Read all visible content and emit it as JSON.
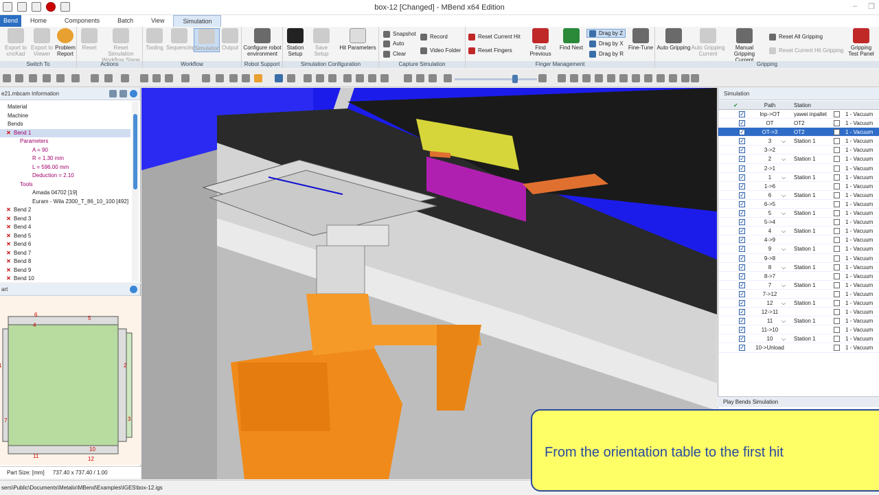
{
  "window": {
    "title": "box-12 [Changed] - MBend x64 Edition"
  },
  "tabs": [
    "Bend",
    "Home",
    "Components",
    "Batch",
    "View",
    "Simulation"
  ],
  "ribbon": {
    "groups": [
      {
        "label": "Switch To"
      },
      {
        "label": "Actions"
      },
      {
        "label": "Workflow"
      },
      {
        "label": "Robot Support"
      },
      {
        "label": "Simulation Configuration"
      },
      {
        "label": "Capture Simulation"
      },
      {
        "label": "Finger Management"
      },
      {
        "label": "Gripping"
      }
    ],
    "buttons": {
      "export_cadcad": "Export to cncKad",
      "export_viewer": "Export to Viewer",
      "problem_report": "Problem Report",
      "reset": "Reset",
      "reset_workflow": "Reset Simulation Workflow Stage",
      "tooling": "Tooling",
      "sequencing": "Sequencing",
      "simulation": "Simulation",
      "output": "Output",
      "configure_robot": "Configure robot environment",
      "station_setup": "Station Setup",
      "save_setup": "Save Setup",
      "hit_parameters": "Hit Parameters",
      "snapshot": "Snapshot",
      "auto": "Auto",
      "clear": "Clear",
      "record": "Record",
      "video_folder": "Video Folder",
      "reset_current_hit": "Reset Current Hit",
      "reset_fingers": "Reset Fingers",
      "find_previous": "Find Previous",
      "find_next": "Find Next",
      "drag_z": "Drag by Z",
      "drag_x": "Drag by X",
      "drag_r": "Drag by R",
      "fine_tune": "Fine-Tune",
      "auto_gripping": "Auto Gripping",
      "auto_gripping_current": "Auto Gripping Current",
      "manual_gripping": "Manual Gripping Current",
      "reset_all_gripping": "Reset All Gripping",
      "reset_current_hit_gripping": "Reset Current Hit Gripping",
      "gripping_test": "Gripping Test Panel"
    }
  },
  "info_panel": {
    "title": "e21.mbcam Information",
    "tree": [
      {
        "label": "Material",
        "indent": 0,
        "mark": "",
        "sel": false,
        "color": ""
      },
      {
        "label": "Machine",
        "indent": 0,
        "mark": "",
        "sel": false,
        "color": ""
      },
      {
        "label": "Bends",
        "indent": 0,
        "mark": "",
        "sel": false,
        "color": ""
      },
      {
        "label": "Bend 1",
        "indent": 1,
        "mark": "✕",
        "sel": true,
        "color": "mag"
      },
      {
        "label": "Parameters",
        "indent": 2,
        "mark": "",
        "sel": false,
        "color": "mag"
      },
      {
        "label": "A = 90",
        "indent": 4,
        "mark": "",
        "sel": false,
        "color": "mag"
      },
      {
        "label": "R = 1.30 mm",
        "indent": 4,
        "mark": "",
        "sel": false,
        "color": "mag"
      },
      {
        "label": "L = 596.00 mm",
        "indent": 4,
        "mark": "",
        "sel": false,
        "color": "mag"
      },
      {
        "label": "Deduction = 2.10",
        "indent": 4,
        "mark": "",
        "sel": false,
        "color": "mag"
      },
      {
        "label": "Tools",
        "indent": 2,
        "mark": "",
        "sel": false,
        "color": "mag"
      },
      {
        "label": "Amada 04702 [19]",
        "indent": 4,
        "mark": "",
        "sel": false,
        "color": ""
      },
      {
        "label": "Euram - Wila 2300_T_86_10_100 [492]",
        "indent": 4,
        "mark": "",
        "sel": false,
        "color": ""
      },
      {
        "label": "Bend 2",
        "indent": 1,
        "mark": "✕",
        "sel": false,
        "color": ""
      },
      {
        "label": "Bend 3",
        "indent": 1,
        "mark": "✕",
        "sel": false,
        "color": ""
      },
      {
        "label": "Bend 4",
        "indent": 1,
        "mark": "✕",
        "sel": false,
        "color": ""
      },
      {
        "label": "Bend 5",
        "indent": 1,
        "mark": "✕",
        "sel": false,
        "color": ""
      },
      {
        "label": "Bend 6",
        "indent": 1,
        "mark": "✕",
        "sel": false,
        "color": ""
      },
      {
        "label": "Bend 7",
        "indent": 1,
        "mark": "✕",
        "sel": false,
        "color": ""
      },
      {
        "label": "Bend 8",
        "indent": 1,
        "mark": "✕",
        "sel": false,
        "color": ""
      },
      {
        "label": "Bend 9",
        "indent": 1,
        "mark": "✕",
        "sel": false,
        "color": ""
      },
      {
        "label": "Bend 10",
        "indent": 1,
        "mark": "✕",
        "sel": false,
        "color": ""
      }
    ]
  },
  "part_panel": {
    "title": "art",
    "numbers": [
      "6",
      "5",
      "4",
      "1",
      "2",
      "7",
      "3",
      "10",
      "11",
      "12"
    ],
    "size_label": "Part Size: [mm]",
    "size_value": "737.40 x 737.40 / 1.00"
  },
  "simulation": {
    "title": "Simulation",
    "columns": {
      "path": "Path",
      "station": "Station"
    },
    "rows": [
      {
        "path": "Inp->OT",
        "station": "yawei inpallet",
        "grip": "1 - Vacuum",
        "exp": false,
        "sel": false
      },
      {
        "path": "OT",
        "station": "OT2",
        "grip": "1 - Vacuum",
        "exp": false,
        "sel": false
      },
      {
        "path": "OT->3",
        "station": "OT2",
        "grip": "1 - Vacuum",
        "exp": false,
        "sel": true
      },
      {
        "path": "3",
        "station": "Station 1",
        "grip": "1 - Vacuum",
        "exp": true,
        "sel": false
      },
      {
        "path": "3->2",
        "station": "",
        "grip": "1 - Vacuum",
        "exp": false,
        "sel": false
      },
      {
        "path": "2",
        "station": "Station 1",
        "grip": "1 - Vacuum",
        "exp": true,
        "sel": false
      },
      {
        "path": "2->1",
        "station": "",
        "grip": "1 - Vacuum",
        "exp": false,
        "sel": false
      },
      {
        "path": "1",
        "station": "Station 1",
        "grip": "1 - Vacuum",
        "exp": true,
        "sel": false
      },
      {
        "path": "1->6",
        "station": "",
        "grip": "1 - Vacuum",
        "exp": false,
        "sel": false
      },
      {
        "path": "6",
        "station": "Station 1",
        "grip": "1 - Vacuum",
        "exp": true,
        "sel": false
      },
      {
        "path": "6->5",
        "station": "",
        "grip": "1 - Vacuum",
        "exp": false,
        "sel": false
      },
      {
        "path": "5",
        "station": "Station 1",
        "grip": "1 - Vacuum",
        "exp": true,
        "sel": false
      },
      {
        "path": "5->4",
        "station": "",
        "grip": "1 - Vacuum",
        "exp": false,
        "sel": false
      },
      {
        "path": "4",
        "station": "Station 1",
        "grip": "1 - Vacuum",
        "exp": true,
        "sel": false
      },
      {
        "path": "4->9",
        "station": "",
        "grip": "1 - Vacuum",
        "exp": false,
        "sel": false
      },
      {
        "path": "9",
        "station": "Station 1",
        "grip": "1 - Vacuum",
        "exp": true,
        "sel": false
      },
      {
        "path": "9->8",
        "station": "",
        "grip": "1 - Vacuum",
        "exp": false,
        "sel": false
      },
      {
        "path": "8",
        "station": "Station 1",
        "grip": "1 - Vacuum",
        "exp": true,
        "sel": false
      },
      {
        "path": "8->7",
        "station": "",
        "grip": "1 - Vacuum",
        "exp": false,
        "sel": false
      },
      {
        "path": "7",
        "station": "Station 1",
        "grip": "1 - Vacuum",
        "exp": true,
        "sel": false
      },
      {
        "path": "7->12",
        "station": "",
        "grip": "1 - Vacuum",
        "exp": false,
        "sel": false
      },
      {
        "path": "12",
        "station": "Station 1",
        "grip": "1 - Vacuum",
        "exp": true,
        "sel": false
      },
      {
        "path": "12->11",
        "station": "",
        "grip": "1 - Vacuum",
        "exp": false,
        "sel": false
      },
      {
        "path": "11",
        "station": "Station 1",
        "grip": "1 - Vacuum",
        "exp": true,
        "sel": false
      },
      {
        "path": "11->10",
        "station": "",
        "grip": "1 - Vacuum",
        "exp": false,
        "sel": false
      },
      {
        "path": "10",
        "station": "Station 1",
        "grip": "1 - Vacuum",
        "exp": true,
        "sel": false
      },
      {
        "path": "10->Unload",
        "station": "",
        "grip": "1 - Vacuum",
        "exp": false,
        "sel": false
      }
    ],
    "play_label": "Play Bends Simulation"
  },
  "status": {
    "path": "sers\\Public\\Documents\\Metalix\\MBend\\Examples\\IGES\\box-12.igs"
  },
  "caption": {
    "text": "From the orientation table to the first hit"
  }
}
